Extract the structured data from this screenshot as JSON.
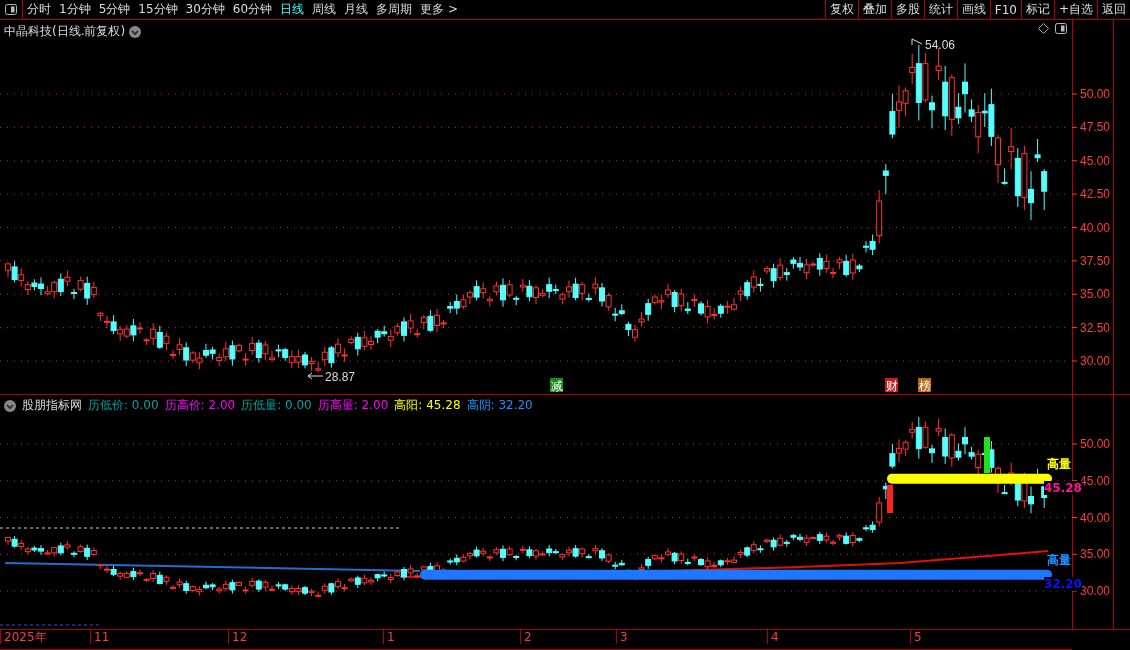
{
  "toolbar": {
    "periods": [
      {
        "label": "分时",
        "selected": false
      },
      {
        "label": "1分钟",
        "selected": false
      },
      {
        "label": "5分钟",
        "selected": false
      },
      {
        "label": "15分钟",
        "selected": false
      },
      {
        "label": "30分钟",
        "selected": false
      },
      {
        "label": "60分钟",
        "selected": false
      },
      {
        "label": "日线",
        "selected": true
      },
      {
        "label": "周线",
        "selected": false
      },
      {
        "label": "月线",
        "selected": false
      },
      {
        "label": "多周期",
        "selected": false
      },
      {
        "label": "更多 >",
        "selected": false
      }
    ],
    "actions": [
      "复权",
      "叠加",
      "多股",
      "统计",
      "画线",
      "F10",
      "标记",
      "+自选",
      "返回"
    ]
  },
  "main_chart": {
    "title": "中晶科技(日线.前复权)",
    "y_axis": [
      "50.00",
      "47.50",
      "45.00",
      "42.50",
      "40.00",
      "37.50",
      "35.00",
      "32.50",
      "30.00"
    ],
    "high_label": "54.06",
    "low_label": "28.87",
    "events": [
      {
        "label": "减",
        "color": "#1a8a1a"
      },
      {
        "label": "财",
        "color": "#c02020"
      },
      {
        "label": "榜",
        "color": "#b86a10"
      }
    ]
  },
  "indicator": {
    "name": "股朋指标网",
    "values": [
      {
        "label": "历低价:",
        "value": "0.00",
        "color": "#00a0a0"
      },
      {
        "label": "历高价:",
        "value": "2.00",
        "color": "#ff00ff"
      },
      {
        "label": "历低量:",
        "value": "0.00",
        "color": "#00a0a0"
      },
      {
        "label": "历高量:",
        "value": "2.00",
        "color": "#ff00ff"
      },
      {
        "label": "高阳:",
        "value": "45.28",
        "color": "#ffff00"
      },
      {
        "label": "高阴:",
        "value": "32.20",
        "color": "#1e90ff"
      }
    ],
    "y_axis": [
      "50.00",
      "45.00",
      "40.00",
      "35.00",
      "30.00"
    ],
    "line_labels": [
      {
        "text": "高量",
        "color": "#ffff00"
      },
      {
        "text": "45.28",
        "color": "#ff1493"
      },
      {
        "text": "高量",
        "color": "#1e90ff"
      },
      {
        "text": "32.20",
        "color": "#1010ff"
      }
    ]
  },
  "date_axis": [
    "2025年",
    "11",
    "12",
    "1",
    "2",
    "3",
    "4",
    "5"
  ]
}
